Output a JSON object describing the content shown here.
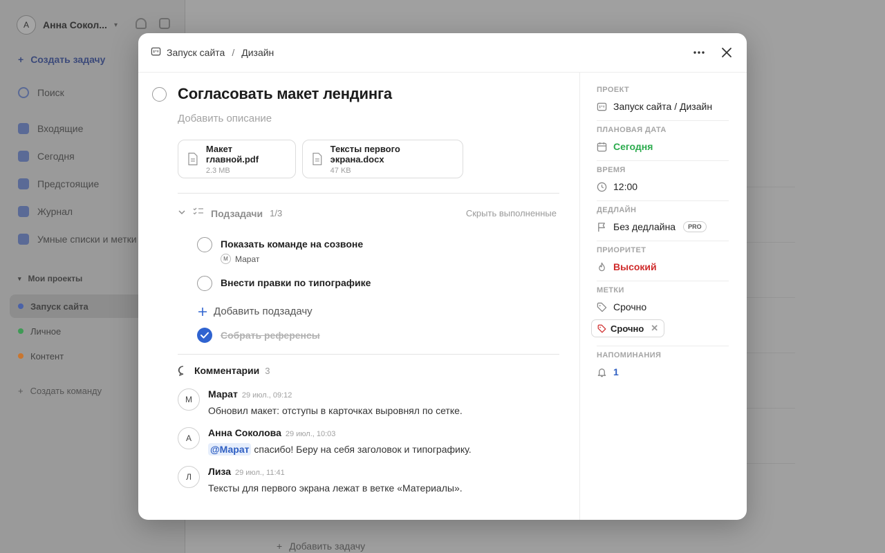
{
  "background": {
    "user_initial": "А",
    "user_name": "Анна Сокол...",
    "create_task": "Создать задачу",
    "nav": [
      "Поиск",
      "Входящие",
      "Сегодня",
      "Предстоящие",
      "Журнал",
      "Умные списки и метки"
    ],
    "projects_section": "Мои проекты",
    "projects": [
      {
        "name": "Запуск сайта",
        "color": "#4a62a8"
      },
      {
        "name": "Личное",
        "color": "#3f9a55"
      },
      {
        "name": "Контент",
        "color": "#c9762f"
      }
    ],
    "create_team": "Создать команду",
    "bottom_add": "Добавить задачу"
  },
  "modal": {
    "breadcrumb": {
      "project": "Запуск сайта",
      "section": "Дизайн",
      "separator": "/"
    },
    "title": "Согласовать макет лендинга",
    "description_placeholder": "Добавить описание",
    "attachments": [
      {
        "name": "Макет главной.pdf",
        "size": "2.3 MB"
      },
      {
        "name": "Тексты первого экрана.docx",
        "size": "47 KB"
      }
    ],
    "subtasks": {
      "label": "Подзадачи",
      "count": "1/3",
      "hide_done": "Скрыть выполненные",
      "items": [
        {
          "text": "Показать команде на созвоне",
          "assignee_initial": "М",
          "assignee": "Марат"
        },
        {
          "text": "Внести правки по типографике"
        }
      ],
      "add_label": "Добавить подзадачу",
      "done_items": [
        {
          "text": "Собрать референсы"
        }
      ]
    },
    "comments": {
      "label": "Комментарии",
      "count": "3",
      "items": [
        {
          "initial": "М",
          "author": "Марат",
          "time": "29 июл., 09:12",
          "text": "Обновил макет: отступы в карточках выровнял по сетке."
        },
        {
          "initial": "А",
          "author": "Анна Соколова",
          "time": "29 июл., 10:03",
          "mention": "@Марат",
          "text": " спасибо! Беру на себя заголовок и типографику."
        },
        {
          "initial": "Л",
          "author": "Лиза",
          "time": "29 июл., 11:41",
          "text": "Тексты для первого экрана лежат в ветке «Материалы»."
        }
      ]
    },
    "properties": {
      "project": {
        "label": "Проект",
        "value": "Запуск сайта / Дизайн"
      },
      "date": {
        "label": "Плановая дата",
        "value": "Сегодня"
      },
      "time": {
        "label": "Время",
        "value": "12:00"
      },
      "deadline": {
        "label": "Дедлайн",
        "value": "Без дедлайна",
        "badge": "PRO"
      },
      "priority": {
        "label": "Приоритет",
        "value": "Высокий"
      },
      "tags": {
        "label": "Метки",
        "value": "Срочно",
        "chip": "Срочно"
      },
      "reminders": {
        "label": "Напоминания",
        "value": "1"
      }
    }
  },
  "colors": {
    "accent": "#2f63d0",
    "green": "#2bab4d",
    "red": "#cf2b2b"
  }
}
